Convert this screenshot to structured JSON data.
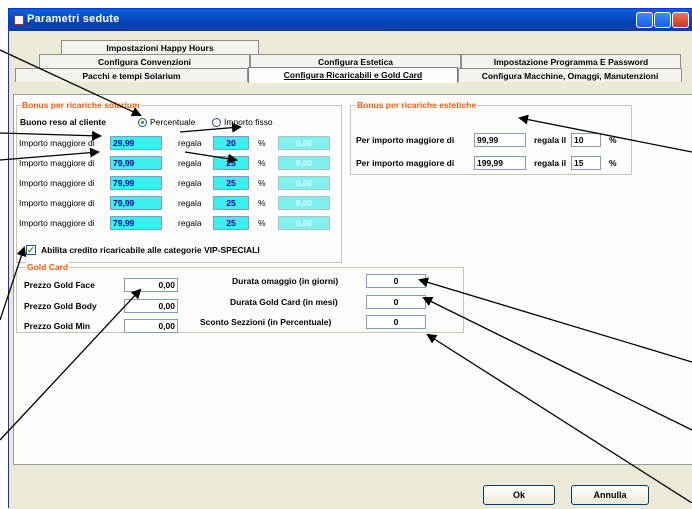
{
  "window": {
    "title": "Parametri sedute"
  },
  "tabs": {
    "row1": [
      "Impostazioni Happy Hours"
    ],
    "row2": [
      "Configura Convenzioni",
      "Configura Estetica",
      "Impostazione Programma E Password"
    ],
    "row3": [
      "Pacchi e tempi Solarium",
      "Configura Ricaricabili e Gold Card",
      "Configura Macchine, Omaggi, Manutenzioni"
    ]
  },
  "solarium_bonus": {
    "title": "Bonus per ricariche solarium",
    "cliente_label": "Buono reso al cliente",
    "radio_percent": "Percentuale",
    "radio_fixed": "Importo fisso",
    "rows": [
      {
        "label": "Importo maggiore di",
        "amount": "29,99",
        "regala": "regala",
        "value": "20",
        "unit": "%",
        "disabled": "0,00"
      },
      {
        "label": "Importo maggiore di",
        "amount": "79,99",
        "regala": "regala",
        "value": "25",
        "unit": "%",
        "disabled": "0,00"
      },
      {
        "label": "Importo maggiore di",
        "amount": "79,99",
        "regala": "regala",
        "value": "25",
        "unit": "%",
        "disabled": "0,00"
      },
      {
        "label": "Importo maggiore di",
        "amount": "79,99",
        "regala": "regala",
        "value": "25",
        "unit": "%",
        "disabled": "0,00"
      },
      {
        "label": "Importo maggiore di",
        "amount": "79,99",
        "regala": "regala",
        "value": "25",
        "unit": "%",
        "disabled": "0,00"
      }
    ],
    "vip_checkbox": "Abilita credito ricaricabile alle categorie VIP-SPECIALI"
  },
  "estetica_bonus": {
    "title": "Bonus per ricariche estetiche",
    "rows": [
      {
        "label": "Per importo maggiore di",
        "amount": "99,99",
        "regala": "regala il",
        "value": "10",
        "unit": "%"
      },
      {
        "label": "Per importo maggiore di",
        "amount": "199,99",
        "regala": "regala il",
        "value": "15",
        "unit": "%"
      }
    ]
  },
  "gold_card": {
    "title": "Gold Card",
    "prices": [
      {
        "label": "Prezzo Gold Face",
        "value": "0,00"
      },
      {
        "label": "Prezzo Gold Body",
        "value": "0,00"
      },
      {
        "label": "Prezzo Gold Min",
        "value": "0,00"
      }
    ],
    "durations": [
      {
        "label": "Durata omaggio (in giorni)",
        "value": "0"
      },
      {
        "label": "Durata Gold Card (in mesi)",
        "value": "0"
      },
      {
        "label": "Sconto Sezzioni (in Percentuale)",
        "value": "0"
      }
    ]
  },
  "buttons": {
    "ok": "Ok",
    "cancel": "Annulla"
  }
}
